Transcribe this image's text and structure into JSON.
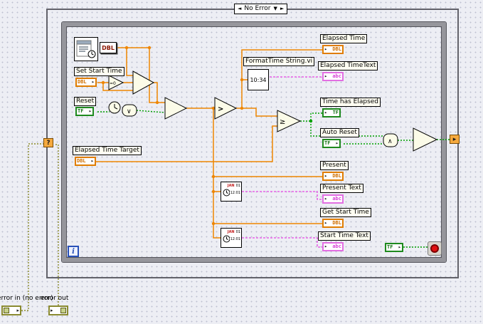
{
  "case_selector": {
    "label": "No Error"
  },
  "glyphs": {
    "arrow": "▸",
    "prev": "◄",
    "next": "►",
    "dropdown": "▼",
    "question": "?"
  },
  "labels": {
    "set_start_time": "Set Start Time",
    "reset": "Reset",
    "elapsed_time_target": "Elapsed Time Target",
    "format_time_vi": "FormatTime String.vi",
    "elapsed_time": "Elapsed Time",
    "elapsed_time_text": "Elapsed TimeText",
    "time_has_elapsed": "Time has Elapsed",
    "auto_reset": "Auto Reset",
    "present": "Present",
    "present_text": "Present Text",
    "get_start_time": "Get Start Time",
    "start_time_text": "Start Time Text",
    "error_in": "error in (no error)",
    "error_out": "error out"
  },
  "terminal_types": {
    "dbl": "DBL",
    "tf": "TF",
    "string": "abc"
  },
  "nodes": {
    "to_double": "DBL",
    "format_time_display": "10:34",
    "equal_zero": "=0",
    "or_gate": "∨",
    "and_gate": "∧",
    "greater": ">",
    "greater_equal": "≥",
    "clock_month": "JAN",
    "clock_day": "01",
    "clock_time": "12:01",
    "iteration": "i"
  }
}
